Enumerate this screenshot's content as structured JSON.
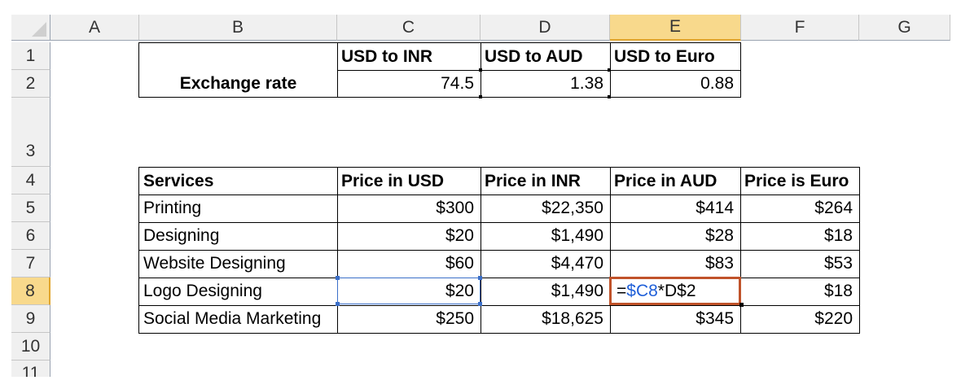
{
  "columns": [
    "A",
    "B",
    "C",
    "D",
    "E",
    "F",
    "G"
  ],
  "rows": [
    "1",
    "2",
    "3",
    "4",
    "5",
    "6",
    "7",
    "8",
    "9",
    "10",
    "11"
  ],
  "selected_column": "E",
  "selected_row": "8",
  "rate_headers": [
    "USD to INR",
    "USD to AUD",
    "USD to Euro"
  ],
  "rate_label": "Exchange rate",
  "rate_values": [
    "74.5",
    "1.38",
    "0.88"
  ],
  "table_headers": [
    "Services",
    "Price in USD",
    "Price in INR",
    "Price in AUD",
    "Price is Euro"
  ],
  "table_rows": [
    [
      "Printing",
      "$300",
      "$22,350",
      "$414",
      "$264"
    ],
    [
      "Designing",
      "$20",
      "$1,490",
      "$28",
      "$18"
    ],
    [
      "Website Designing",
      "$60",
      "$4,470",
      "$83",
      "$53"
    ],
    [
      "Logo Designing",
      "$20",
      "$1,490",
      "",
      "$18"
    ],
    [
      "Social Media Marketing",
      "$250",
      "$18,625",
      "$345",
      "$220"
    ]
  ],
  "editing_formula": {
    "prefix": "=",
    "ref1": "$C8",
    "rest": "*D$2"
  },
  "colors": {
    "header_bg": "#f0f0f0",
    "selected_header_bg": "#f8d98c",
    "edit_box_border": "#c0532a",
    "formula_ref_color": "#1f5fd8",
    "selection_border": "#3b6fc9"
  }
}
